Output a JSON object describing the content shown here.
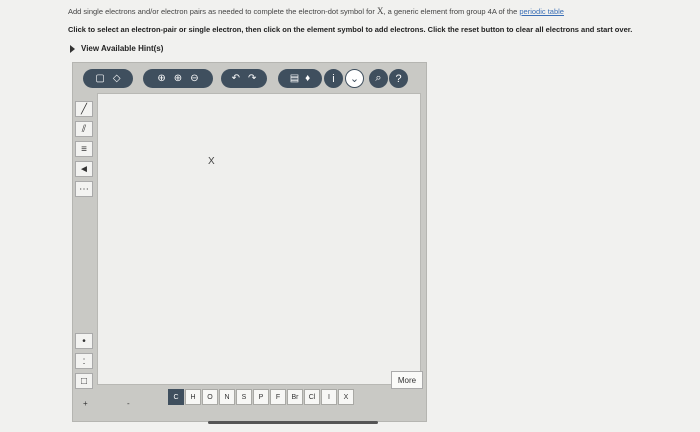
{
  "instructions": {
    "line1_prefix": "Add single electrons and/or electron pairs as needed to complete the electron-dot symbol for ",
    "line1_element": "X",
    "line1_mid": ", a generic element from group 4A of the ",
    "line1_link": "periodic table",
    "line2": "Click to select an electron-pair or single electron, then click on the element symbol to add electrons. Click the reset button to clear all electrons and start over."
  },
  "hints": {
    "label": "View Available Hint(s)"
  },
  "toolbar": {
    "info_label": "i",
    "help_label": "?"
  },
  "canvas": {
    "element_symbol": "X"
  },
  "sidebar": {
    "pair_label": ":",
    "charge_plus": "+",
    "charge_minus": "-"
  },
  "periodic": {
    "elements": [
      "C",
      "H",
      "O",
      "N",
      "S",
      "P",
      "F",
      "Br",
      "Cl",
      "I",
      "X"
    ],
    "more_label": "More"
  }
}
